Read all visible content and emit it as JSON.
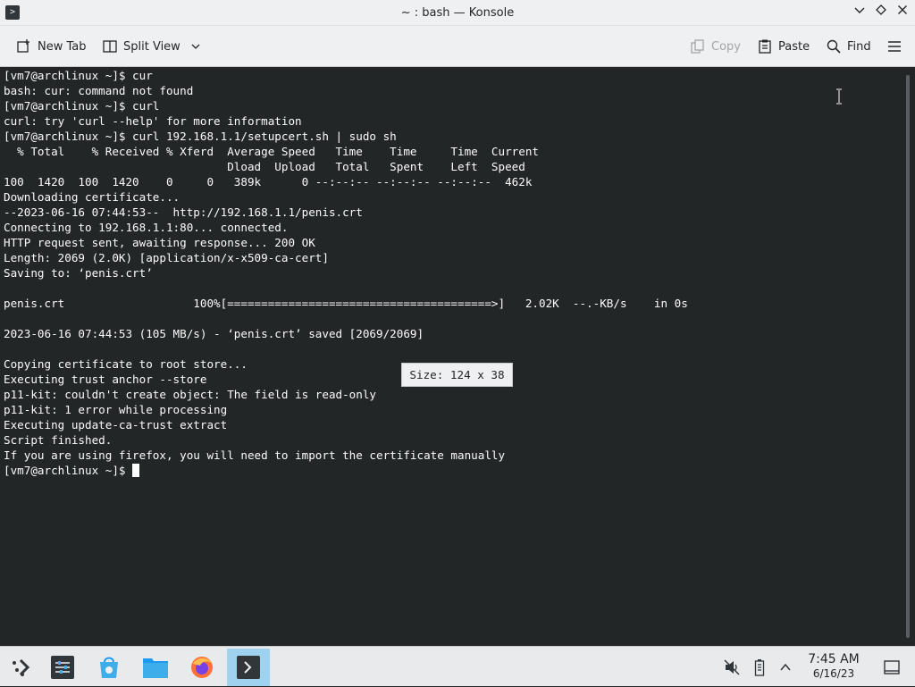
{
  "window": {
    "title": "~ : bash — Konsole",
    "app_icon_glyph": ">",
    "controls": [
      "minimize",
      "maximize",
      "close"
    ]
  },
  "toolbar": {
    "new_tab": "New Tab",
    "split_view": "Split View",
    "copy": "Copy",
    "paste": "Paste",
    "find": "Find"
  },
  "terminal": {
    "lines": [
      "[vm7@archlinux ~]$ cur",
      "bash: cur: command not found",
      "[vm7@archlinux ~]$ curl",
      "curl: try 'curl --help' for more information",
      "[vm7@archlinux ~]$ curl 192.168.1.1/setupcert.sh | sudo sh",
      "  % Total    % Received % Xferd  Average Speed   Time    Time     Time  Current",
      "                                 Dload  Upload   Total   Spent    Left  Speed",
      "100  1420  100  1420    0     0   389k      0 --:--:-- --:--:-- --:--:--  462k",
      "Downloading certificate...",
      "--2023-06-16 07:44:53--  http://192.168.1.1/penis.crt",
      "Connecting to 192.168.1.1:80... connected.",
      "HTTP request sent, awaiting response... 200 OK",
      "Length: 2069 (2.0K) [application/x-x509-ca-cert]",
      "Saving to: ‘penis.crt’",
      "",
      "penis.crt                   100%[=======================================>]   2.02K  --.-KB/s    in 0s",
      "",
      "2023-06-16 07:44:53 (105 MB/s) - ‘penis.crt’ saved [2069/2069]",
      "",
      "Copying certificate to root store...",
      "Executing trust anchor --store",
      "p11-kit: couldn't create object: The field is read-only",
      "p11-kit: 1 error while processing",
      "Executing update-ca-trust extract",
      "Script finished.",
      "If you are using firefox, you will need to import the certificate manually"
    ],
    "prompt": "[vm7@archlinux ~]$ ",
    "size_tooltip": "Size: 124 x 38"
  },
  "taskbar": {
    "items": [
      "application-launcher-icon",
      "system-settings-icon",
      "discover-icon",
      "file-manager-icon",
      "firefox-icon",
      "konsole-icon"
    ],
    "active_item": "konsole-icon",
    "tray": [
      "volume-muted-icon",
      "battery-icon",
      "expand-tray-icon"
    ],
    "clock_time": "7:45 AM",
    "clock_date": "6/16/23"
  },
  "colors": {
    "terminal_bg": "#232627",
    "terminal_fg": "#fcfcfc",
    "chrome_bg": "#eff0f1",
    "active_task": "#9fd2ef",
    "firefox_orange": "#ff7139"
  }
}
